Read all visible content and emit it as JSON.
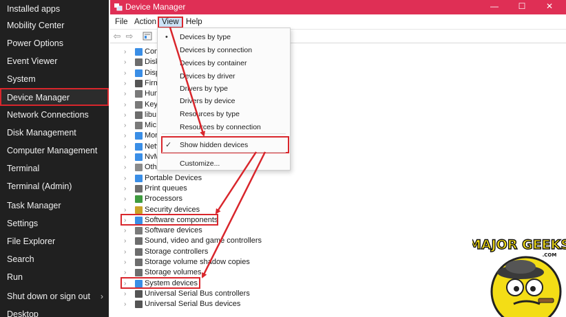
{
  "winx_menu": {
    "items": [
      {
        "label": "Installed apps"
      },
      {
        "label": "Mobility Center"
      },
      {
        "label": "Power Options"
      },
      {
        "label": "Event Viewer"
      },
      {
        "label": "System"
      },
      {
        "label": "Device Manager",
        "selected": true
      },
      {
        "label": "Network Connections"
      },
      {
        "label": "Disk Management"
      },
      {
        "label": "Computer Management"
      },
      {
        "label": "Terminal"
      },
      {
        "label": "Terminal (Admin)"
      },
      {
        "label": "Task Manager"
      },
      {
        "label": "Settings"
      },
      {
        "label": "File Explorer"
      },
      {
        "label": "Search"
      },
      {
        "label": "Run"
      },
      {
        "label": "Shut down or sign out",
        "has_submenu": true
      },
      {
        "label": "Desktop"
      }
    ],
    "submenu_glyph": "›"
  },
  "window": {
    "title": "Device Manager",
    "title_bar_color": "#df2f55",
    "controls": {
      "minimize": "—",
      "maximize": "☐",
      "close": "✕"
    },
    "menu": [
      "File",
      "Action",
      "View",
      "Help"
    ],
    "open_menu": "View"
  },
  "toolbar": {
    "back": "⇦",
    "forward": "⇨"
  },
  "tree": [
    {
      "label": "Com",
      "icon": "monitor-icon",
      "color": "#3a8ee6"
    },
    {
      "label": "Disk",
      "icon": "disk-drive-icon",
      "color": "#6d6d6d"
    },
    {
      "label": "Disp",
      "icon": "display-adapter-icon",
      "color": "#3a8ee6"
    },
    {
      "label": "Firm",
      "icon": "firmware-icon",
      "color": "#555555"
    },
    {
      "label": "Hun",
      "icon": "keyboard-icon",
      "color": "#7a7a7a"
    },
    {
      "label": "Keyl",
      "icon": "keyboard-icon",
      "color": "#7a7a7a"
    },
    {
      "label": "libu",
      "icon": "usb-device-icon",
      "color": "#6d6d6d"
    },
    {
      "label": "Mic",
      "icon": "mouse-icon",
      "color": "#7a7a7a"
    },
    {
      "label": "Mor",
      "icon": "monitor-icon",
      "color": "#3a8ee6"
    },
    {
      "label": "Netv",
      "icon": "network-adapter-icon",
      "color": "#3a8ee6"
    },
    {
      "label": "NvM",
      "icon": "storage-controller-icon",
      "color": "#3a8ee6"
    },
    {
      "label": "Othe",
      "icon": "other-devices-icon",
      "color": "#8a8a8a"
    },
    {
      "label": "Portable Devices",
      "icon": "portable-device-icon",
      "color": "#3a8ee6"
    },
    {
      "label": "Print queues",
      "icon": "printer-icon",
      "color": "#6d6d6d"
    },
    {
      "label": "Processors",
      "icon": "processor-icon",
      "color": "#3f9b3f"
    },
    {
      "label": "Security devices",
      "icon": "security-device-icon",
      "color": "#c9a227"
    },
    {
      "label": "Software components",
      "icon": "software-component-icon",
      "color": "#3a8ee6",
      "highlight": true
    },
    {
      "label": "Software devices",
      "icon": "software-device-icon",
      "color": "#7a7a7a"
    },
    {
      "label": "Sound, video and game controllers",
      "icon": "speaker-icon",
      "color": "#6d6d6d"
    },
    {
      "label": "Storage controllers",
      "icon": "storage-controller-icon",
      "color": "#6d6d6d"
    },
    {
      "label": "Storage volume shadow copies",
      "icon": "disk-drive-icon",
      "color": "#6d6d6d"
    },
    {
      "label": "Storage volumes",
      "icon": "disk-drive-icon",
      "color": "#6d6d6d"
    },
    {
      "label": "System devices",
      "icon": "system-device-icon",
      "color": "#3a8ee6",
      "highlight": true
    },
    {
      "label": "Universal Serial Bus controllers",
      "icon": "usb-icon",
      "color": "#555555"
    },
    {
      "label": "Universal Serial Bus devices",
      "icon": "usb-icon",
      "color": "#555555"
    }
  ],
  "view_menu": {
    "items": [
      {
        "label": "Devices by type",
        "mark": "•"
      },
      {
        "label": "Devices by connection",
        "mark": ""
      },
      {
        "label": "Devices by container",
        "mark": ""
      },
      {
        "label": "Devices by driver",
        "mark": ""
      },
      {
        "label": "Drivers by type",
        "mark": ""
      },
      {
        "label": "Drivers by device",
        "mark": ""
      },
      {
        "label": "Resources by type",
        "mark": ""
      },
      {
        "label": "Resources by connection",
        "mark": ""
      },
      {
        "label": "Show hidden devices",
        "mark": "✓",
        "highlight": true
      },
      {
        "label": "Customize...",
        "mark": ""
      }
    ]
  },
  "annotation_color": "#d9262c",
  "logo": {
    "text": "MAJOR GEEKS",
    "suffix": ".COM"
  }
}
